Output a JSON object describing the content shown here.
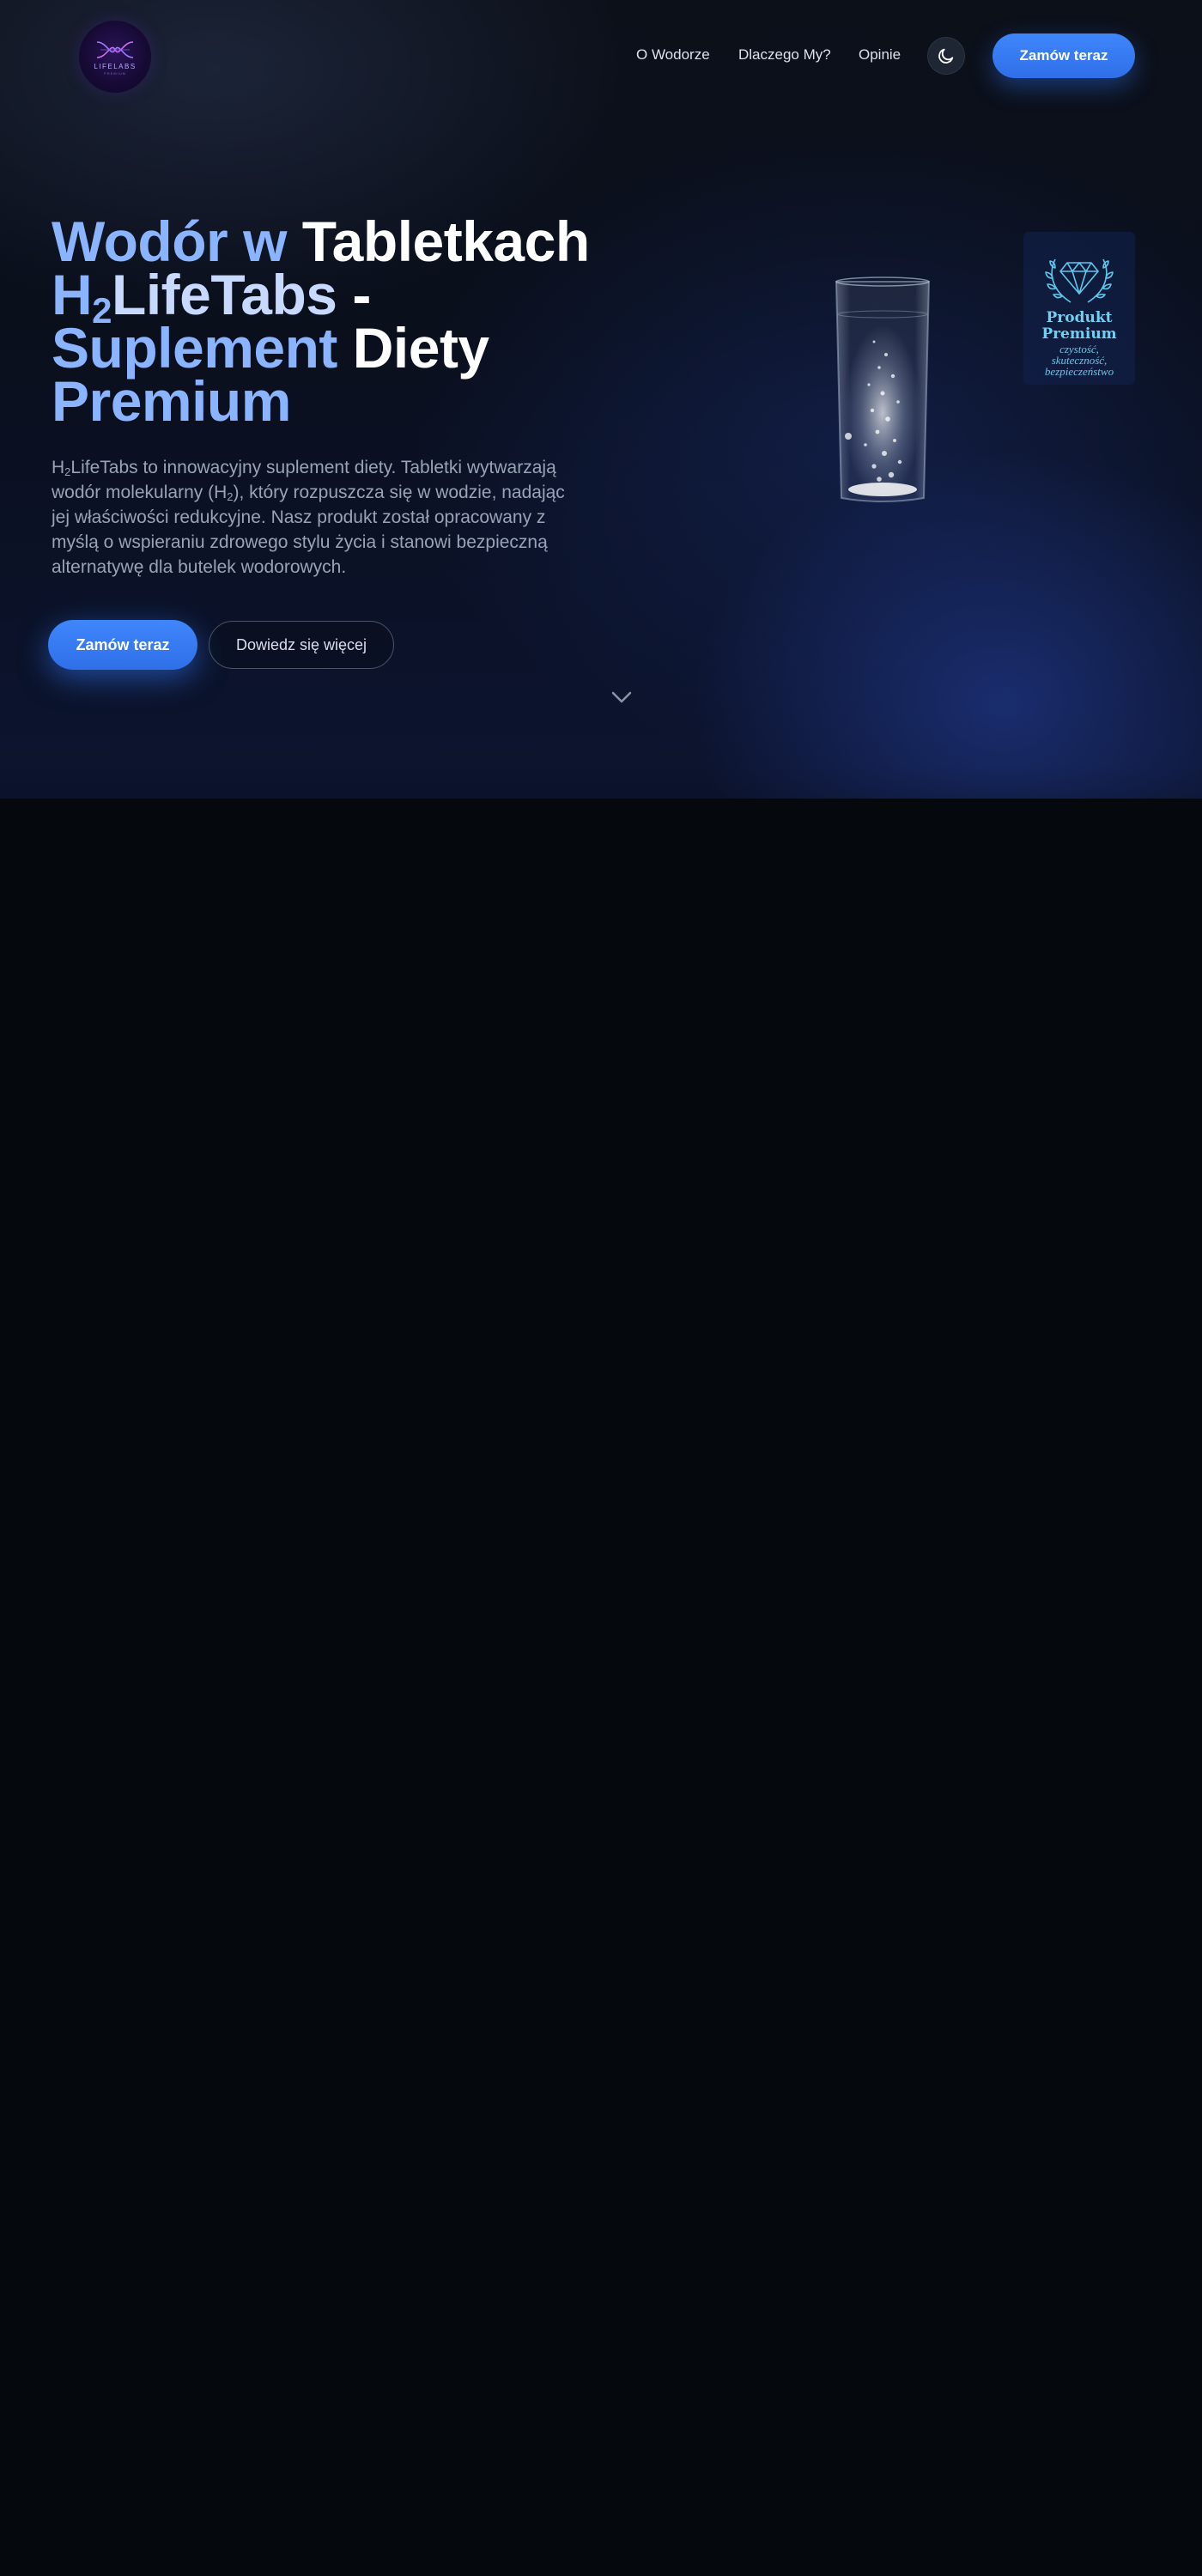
{
  "nav": {
    "logo_text": "LIFELABS",
    "logo_subtext": "PREMIUM",
    "links": [
      {
        "label": "O Wodorze"
      },
      {
        "label": "Dlaczego My?"
      },
      {
        "label": "Opinie"
      }
    ],
    "theme_toggle_icon": "moon-icon",
    "cta_label": "Zamów teraz"
  },
  "hero": {
    "headline": {
      "part1": "Wodór w",
      "part2": "Tabletkach",
      "part3_prefix": "H",
      "part3_sub": "2",
      "part3_suffix": "LifeTabs",
      "part4": "-",
      "part5": "Suplement",
      "part6": "Diety",
      "part7": "Premium"
    },
    "lead": {
      "part1": "H",
      "sub1": "2",
      "part2": "LifeTabs to innowacyjny suplement diety. Tabletki wytwarzają wodór molekularny (H",
      "sub2": "2",
      "part3": "), który rozpuszcza się w wodzie, nadając jej właściwości redukcyjne. Nasz produkt został opracowany z myślą o wspieraniu zdrowego stylu życia i stanowi bezpieczną alternatywę dla butelek wodorowych."
    },
    "primary_cta": "Zamów teraz",
    "secondary_cta": "Dowiedz się więcej",
    "scroll_icon": "chevron-down-icon",
    "product_image": "glass-with-effervescent-tablet",
    "badge": {
      "icon": "diamond-laurel-icon",
      "title_line1": "Produkt",
      "title_line2": "Premium",
      "subtitle": "czystość, skuteczność, bezpieczeństwo"
    }
  },
  "colors": {
    "accent": "#3f86fb",
    "headline_blue": "#8ab4ff",
    "headline_light": "#c7d9ff",
    "badge_cyan": "#6fd0f2",
    "background": "#05080d"
  }
}
